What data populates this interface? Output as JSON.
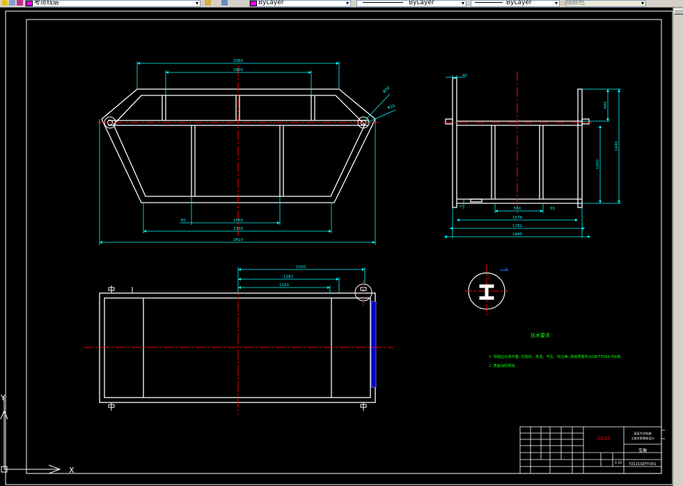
{
  "toolbar": {
    "layer_dropdown": "考虑线层",
    "color_dropdown": "ByLayer",
    "linetype_dropdown": "ByLayer",
    "lineweight_dropdown": "ByLayer",
    "plotstyle_dropdown": "随颜色",
    "colors": {
      "swatch": "#ff00ff"
    }
  },
  "drawing": {
    "colors": {
      "outline": "#ffffff",
      "dimension": "#00ffff",
      "centerline": "#ff0000",
      "note_text": "#00ff00",
      "material_text": "#ff0000",
      "side_plate": "#0000cc"
    },
    "front_view": {
      "dim_top_outer": "2080",
      "dim_top_inner": "1900",
      "dim_angle_1": "Φ50",
      "dim_angle_2": "Φ20",
      "dim_small": "50",
      "dim_mid": "1060",
      "dim_bottom_inner": "2330",
      "dim_bottom_overall": "2810"
    },
    "side_view": {
      "dim_top": "40",
      "dim_right_1": "440",
      "dim_right_2": "1440",
      "dim_right_3": "1000",
      "dim_left_small": "3",
      "dim_inner": "550",
      "dim_small_right": "55",
      "dim_row1": "1578",
      "dim_row2": "1782",
      "dim_row3": "1845"
    },
    "plan_view": {
      "dim_1": "1500",
      "dim_2": "1282",
      "dim_3": "1150"
    },
    "detail": {
      "label": "A"
    },
    "notes": {
      "title": "技术要求",
      "line1": "1. 焊缝应光滑平整, 无裂纹、夹渣、气孔、咬边等, 焊缝质量符合GB/T3594.3标准;",
      "line2": "2. 表面涂防锈漆."
    },
    "title_block": {
      "material": "Q235",
      "part_name": "车厢",
      "drawing_no": "YZ1210ZFY-001",
      "company_line1": "某某大学机械",
      "company_line2": "工程学院课程设计",
      "scale": "1:10"
    },
    "ucs": {
      "x_label": "X",
      "y_label": "Y"
    }
  }
}
